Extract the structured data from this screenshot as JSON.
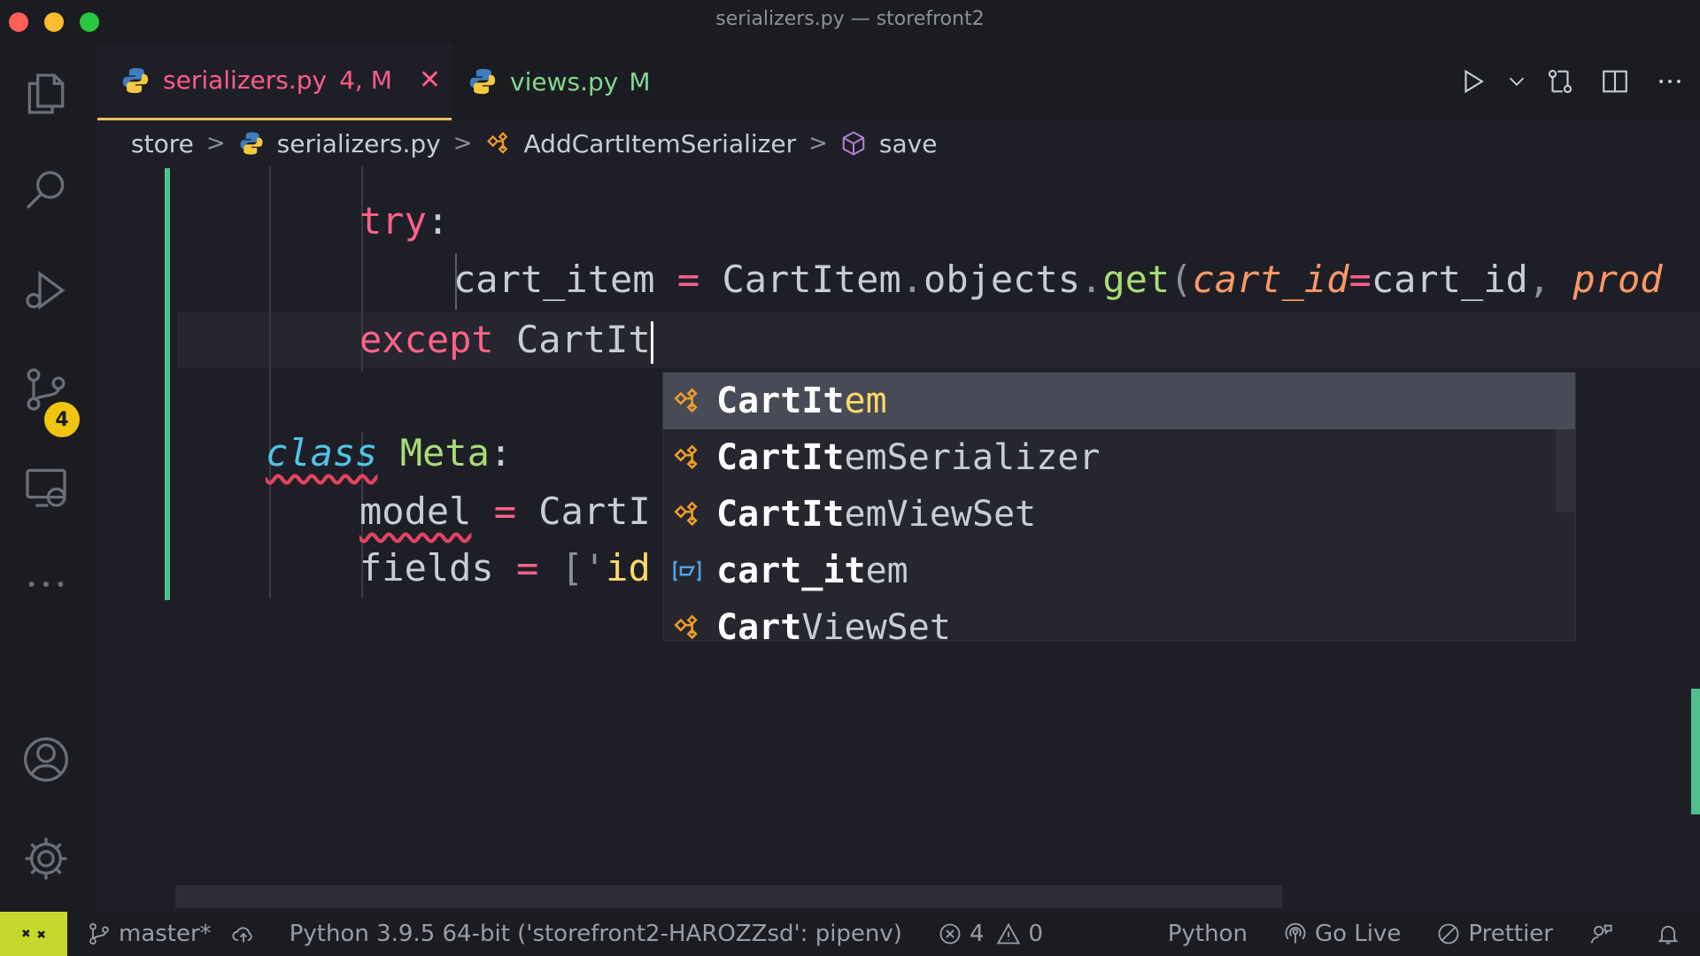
{
  "window": {
    "title": "serializers.py — storefront2"
  },
  "activity_bar": {
    "source_control_badge": "4"
  },
  "tabs": [
    {
      "name": "serializers.py",
      "status": "4, M",
      "active": true
    },
    {
      "name": "views.py",
      "status": "M",
      "active": false
    }
  ],
  "breadcrumb": {
    "folder": "store",
    "file": "serializers.py",
    "class": "AddCartItemSerializer",
    "method": "save"
  },
  "code": {
    "line1": {
      "kw": "try",
      "punct": ":"
    },
    "line2": {
      "var": "cart_item",
      "eq": " = ",
      "cls": "CartItem",
      "dot1": ".",
      "attr": "objects",
      "dot2": ".",
      "fn": "get",
      "paren": "(",
      "param1": "cart_id",
      "eq2": "=",
      "val1": "cart_id",
      "comma": ", ",
      "param2": "prod"
    },
    "line3": {
      "kw": "except",
      "typed": "CartIt"
    },
    "line4": {
      "kw": "class",
      "name": "Meta",
      "punct": ":"
    },
    "line5": {
      "var": "model",
      "eq": " = ",
      "val": "CartI"
    },
    "line6": {
      "var": "fields",
      "eq": " = ",
      "open": "[",
      "quote": "'",
      "str": "id"
    }
  },
  "suggestions": {
    "typed": "CartIt",
    "items": [
      {
        "match": "CartIt",
        "rest": "em",
        "kind": "class-icon"
      },
      {
        "match": "CartIt",
        "rest": "emSerializer",
        "kind": "class-icon"
      },
      {
        "match": "CartIt",
        "rest": "emViewSet",
        "kind": "class-icon"
      },
      {
        "match": "cart_it",
        "rest": "em",
        "kind": "variable-icon"
      },
      {
        "match": "Cart",
        "rest": "ViewSet",
        "kind": "class-icon"
      }
    ]
  },
  "status_bar": {
    "branch": "master*",
    "interpreter": "Python 3.9.5 64-bit ('storefront2-HAROZZsd': pipenv)",
    "errors": "4",
    "warnings": "0",
    "language": "Python",
    "go_live": "Go Live",
    "prettier": "Prettier"
  },
  "colors": {
    "accent_active_tab": "#ff5c8a",
    "modified_tab": "#7fd88f",
    "badge": "#f1c40f",
    "remote_indicator": "#c5d82e",
    "git_gutter": "#4fc08d"
  }
}
